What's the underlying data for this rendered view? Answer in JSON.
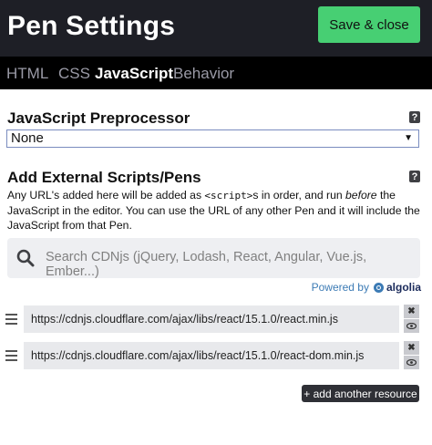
{
  "header": {
    "title": "Pen Settings",
    "save_label": "Save & close"
  },
  "tabs": [
    {
      "label": "HTML",
      "active": false
    },
    {
      "label": "CSS",
      "active": false
    },
    {
      "label": "JavaScript",
      "active": true
    },
    {
      "label": "Behavior",
      "active": false
    }
  ],
  "preprocessor": {
    "title": "JavaScript Preprocessor",
    "help": "?",
    "selected": "None",
    "arrow": "▼"
  },
  "external": {
    "title": "Add External Scripts/Pens",
    "help": "?",
    "desc_1": "Any URL's added here will be added as ",
    "desc_code": "<script>",
    "desc_2": "s in order, and run ",
    "desc_em": "before",
    "desc_3": " the JavaScript in the editor. You can use the URL of any other Pen and it will include the JavaScript from that Pen.",
    "search_placeholder": "Search CDNjs (jQuery, Lodash, React, Angular, Vue.js, Ember...)",
    "powered_by": "Powered by",
    "algolia": "algolia",
    "resources": [
      {
        "url": "https://cdnjs.cloudflare.com/ajax/libs/react/15.1.0/react.min.js"
      },
      {
        "url": "https://cdnjs.cloudflare.com/ajax/libs/react/15.1.0/react-dom.min.js"
      }
    ],
    "remove_glyph": "✖",
    "view_glyph": "👁",
    "add_label": "+ add another resource"
  },
  "colors": {
    "accent": "#47cf73",
    "header_bg": "#1e1f26",
    "tabs_bg": "#000000",
    "link": "#3c7bb5"
  }
}
